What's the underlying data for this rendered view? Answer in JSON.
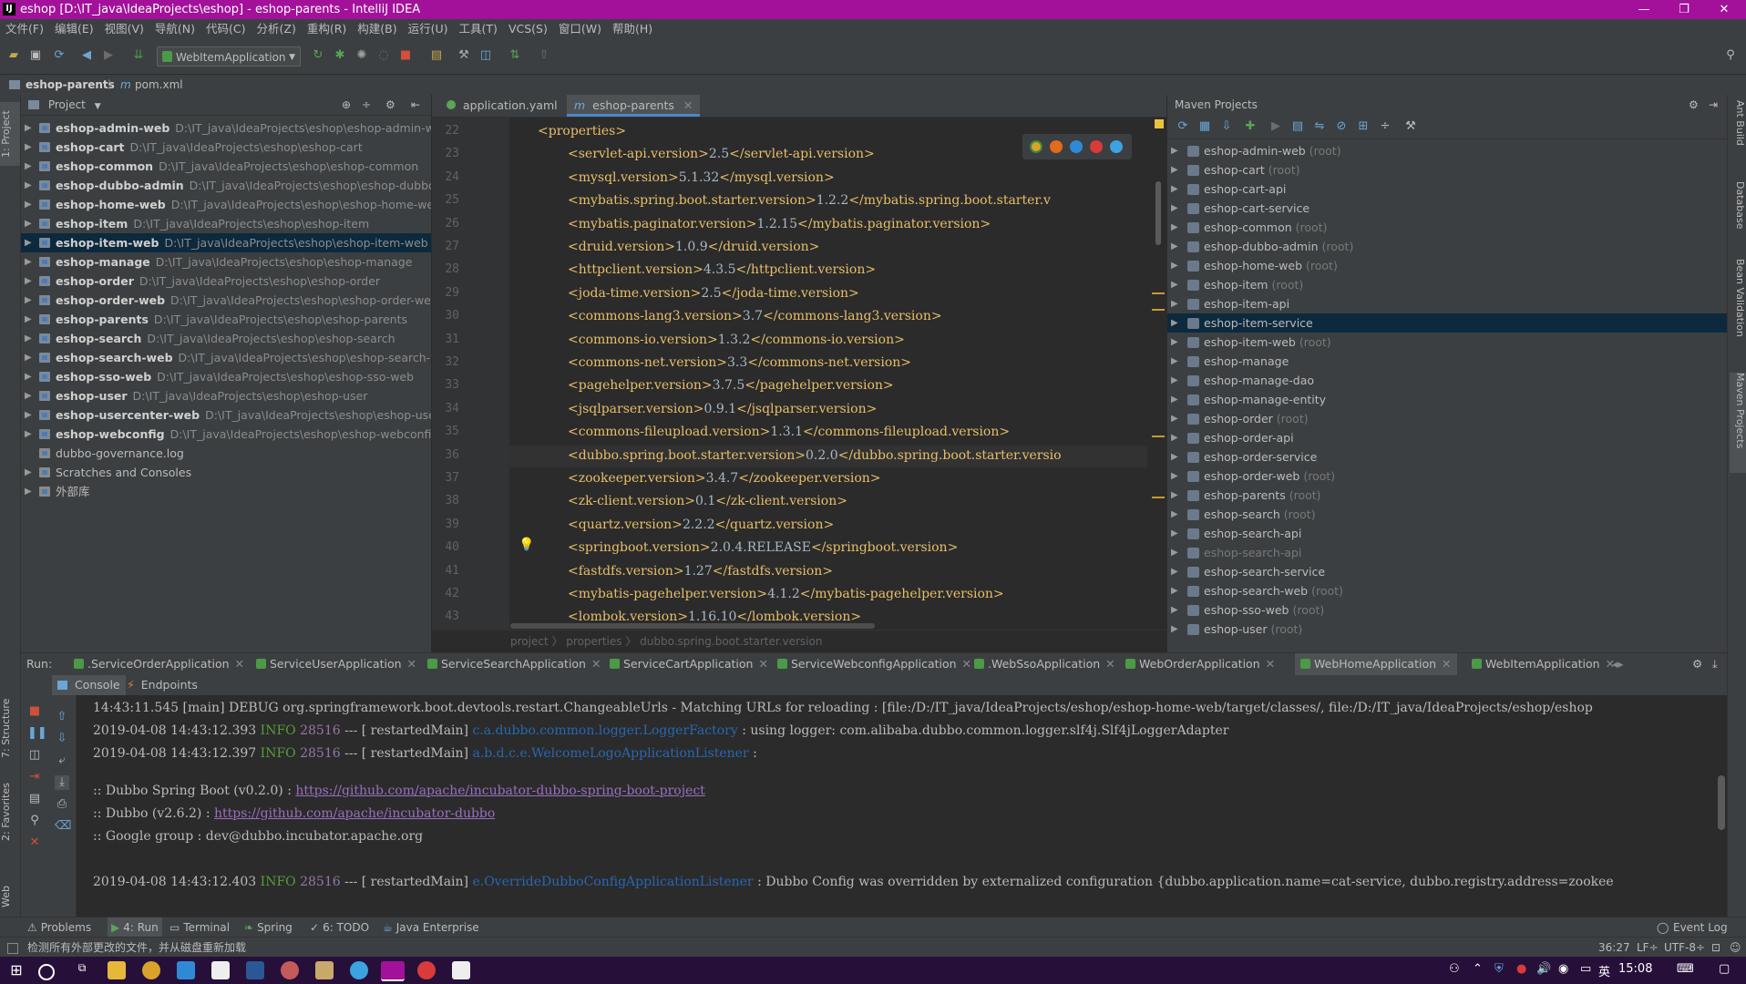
{
  "titlebar": {
    "app_icon": "IJ",
    "title": "eshop [D:\\IT_java\\IdeaProjects\\eshop] - eshop-parents - IntelliJ IDEA",
    "minimize": "—",
    "restore": "❐",
    "close": "✕"
  },
  "menu": [
    "文件(F)",
    "编辑(E)",
    "视图(V)",
    "导航(N)",
    "代码(C)",
    "分析(Z)",
    "重构(R)",
    "构建(B)",
    "运行(U)",
    "工具(T)",
    "VCS(S)",
    "窗口(W)",
    "帮助(H)"
  ],
  "toolbar": {
    "run_config": "WebItemApplication"
  },
  "navbar": {
    "project": "eshop-parents",
    "file_prefix": "m",
    "file": "pom.xml"
  },
  "left_stripe": {
    "project_tab": "1: Project",
    "structure_tab": "7: Structure",
    "favorites_tab": "2: Favorites",
    "web_tab": "Web"
  },
  "project_panel": {
    "header": "Project",
    "items": [
      {
        "name": "eshop-admin-web",
        "path": "D:\\IT_java\\IdeaProjects\\eshop\\eshop-admin-web"
      },
      {
        "name": "eshop-cart",
        "path": "D:\\IT_java\\IdeaProjects\\eshop\\eshop-cart"
      },
      {
        "name": "eshop-common",
        "path": "D:\\IT_java\\IdeaProjects\\eshop\\eshop-common"
      },
      {
        "name": "eshop-dubbo-admin",
        "path": "D:\\IT_java\\IdeaProjects\\eshop\\eshop-dubbo-ad"
      },
      {
        "name": "eshop-home-web",
        "path": "D:\\IT_java\\IdeaProjects\\eshop\\eshop-home-web"
      },
      {
        "name": "eshop-item",
        "path": "D:\\IT_java\\IdeaProjects\\eshop\\eshop-item"
      },
      {
        "name": "eshop-item-web",
        "path": "D:\\IT_java\\IdeaProjects\\eshop\\eshop-item-web"
      },
      {
        "name": "eshop-manage",
        "path": "D:\\IT_java\\IdeaProjects\\eshop\\eshop-manage"
      },
      {
        "name": "eshop-order",
        "path": "D:\\IT_java\\IdeaProjects\\eshop\\eshop-order"
      },
      {
        "name": "eshop-order-web",
        "path": "D:\\IT_java\\IdeaProjects\\eshop\\eshop-order-web"
      },
      {
        "name": "eshop-parents",
        "path": "D:\\IT_java\\IdeaProjects\\eshop\\eshop-parents"
      },
      {
        "name": "eshop-search",
        "path": "D:\\IT_java\\IdeaProjects\\eshop\\eshop-search"
      },
      {
        "name": "eshop-search-web",
        "path": "D:\\IT_java\\IdeaProjects\\eshop\\eshop-search-web"
      },
      {
        "name": "eshop-sso-web",
        "path": "D:\\IT_java\\IdeaProjects\\eshop\\eshop-sso-web"
      },
      {
        "name": "eshop-user",
        "path": "D:\\IT_java\\IdeaProjects\\eshop\\eshop-user"
      },
      {
        "name": "eshop-usercenter-web",
        "path": "D:\\IT_java\\IdeaProjects\\eshop\\eshop-usercent"
      },
      {
        "name": "eshop-webconfig",
        "path": "D:\\IT_java\\IdeaProjects\\eshop\\eshop-webconfig"
      }
    ],
    "selected_index": 6,
    "log_file": "dubbo-governance.log",
    "scratches": "Scratches and Consoles",
    "external_libs": "外部库"
  },
  "editor": {
    "tabs": [
      {
        "label": "application.yaml"
      },
      {
        "label": "eshop-parents",
        "prefix": "m"
      }
    ],
    "lines": [
      {
        "num": "22",
        "indent": 0,
        "open": "<properties>",
        "value": "",
        "close": ""
      },
      {
        "num": "23",
        "indent": 1,
        "open": "<servlet-api.version>",
        "value": "2.5",
        "close": "</servlet-api.version>"
      },
      {
        "num": "24",
        "indent": 1,
        "open": "<mysql.version>",
        "value": "5.1.32",
        "close": "</mysql.version>"
      },
      {
        "num": "25",
        "indent": 1,
        "open": "<mybatis.spring.boot.starter.version>",
        "value": "1.2.2",
        "close": "</mybatis.spring.boot.starter.v"
      },
      {
        "num": "26",
        "indent": 1,
        "open": "<mybatis.paginator.version>",
        "value": "1.2.15",
        "close": "</mybatis.paginator.version>"
      },
      {
        "num": "27",
        "indent": 1,
        "open": "<druid.version>",
        "value": "1.0.9",
        "close": "</druid.version>"
      },
      {
        "num": "28",
        "indent": 1,
        "open": "<httpclient.version>",
        "value": "4.3.5",
        "close": "</httpclient.version>"
      },
      {
        "num": "29",
        "indent": 1,
        "open": "<joda-time.version>",
        "value": "2.5",
        "close": "</joda-time.version>"
      },
      {
        "num": "30",
        "indent": 1,
        "open": "<commons-lang3.version>",
        "value": "3.7",
        "close": "</commons-lang3.version>"
      },
      {
        "num": "31",
        "indent": 1,
        "open": "<commons-io.version>",
        "value": "1.3.2",
        "close": "</commons-io.version>"
      },
      {
        "num": "32",
        "indent": 1,
        "open": "<commons-net.version>",
        "value": "3.3",
        "close": "</commons-net.version>"
      },
      {
        "num": "33",
        "indent": 1,
        "open": "<pagehelper.version>",
        "value": "3.7.5",
        "close": "</pagehelper.version>"
      },
      {
        "num": "34",
        "indent": 1,
        "open": "<jsqlparser.version>",
        "value": "0.9.1",
        "close": "</jsqlparser.version>"
      },
      {
        "num": "35",
        "indent": 1,
        "open": "<commons-fileupload.version>",
        "value": "1.3.1",
        "close": "</commons-fileupload.version>"
      },
      {
        "num": "36",
        "indent": 1,
        "open": "<dubbo.spring.boot.starter.version>",
        "value": "0.2.0",
        "close": "</dubbo.spring.boot.starter.versio"
      },
      {
        "num": "37",
        "indent": 1,
        "open": "<zookeeper.version>",
        "value": "3.4.7",
        "close": "</zookeeper.version>"
      },
      {
        "num": "38",
        "indent": 1,
        "open": "<zk-client.version>",
        "value": "0.1",
        "close": "</zk-client.version>"
      },
      {
        "num": "39",
        "indent": 1,
        "open": "<quartz.version>",
        "value": "2.2.2",
        "close": "</quartz.version>"
      },
      {
        "num": "40",
        "indent": 1,
        "open": "<springboot.version>",
        "value": "2.0.4.RELEASE",
        "close": "</springboot.version>"
      },
      {
        "num": "41",
        "indent": 1,
        "open": "<fastdfs.version>",
        "value": "1.27",
        "close": "</fastdfs.version>"
      },
      {
        "num": "42",
        "indent": 1,
        "open": "<mybatis-pagehelper.version>",
        "value": "4.1.2",
        "close": "</mybatis-pagehelper.version>"
      },
      {
        "num": "43",
        "indent": 1,
        "open": "<lombok.version>",
        "value": "1.16.10",
        "close": "</lombok.version>"
      }
    ],
    "breadcrumb": "project  〉 properties  〉 dubbo.spring.boot.starter.version"
  },
  "maven": {
    "header": "Maven Projects",
    "items": [
      {
        "name": "eshop-admin-web",
        "root": "(root)"
      },
      {
        "name": "eshop-cart",
        "root": "(root)"
      },
      {
        "name": "eshop-cart-api",
        "root": ""
      },
      {
        "name": "eshop-cart-service",
        "root": ""
      },
      {
        "name": "eshop-common",
        "root": "(root)"
      },
      {
        "name": "eshop-dubbo-admin",
        "root": "(root)"
      },
      {
        "name": "eshop-home-web",
        "root": "(root)"
      },
      {
        "name": "eshop-item",
        "root": "(root)"
      },
      {
        "name": "eshop-item-api",
        "root": ""
      },
      {
        "name": "eshop-item-service",
        "root": ""
      },
      {
        "name": "eshop-item-web",
        "root": "(root)"
      },
      {
        "name": "eshop-manage",
        "root": ""
      },
      {
        "name": "eshop-manage-dao",
        "root": ""
      },
      {
        "name": "eshop-manage-entity",
        "root": ""
      },
      {
        "name": "eshop-order",
        "root": "(root)"
      },
      {
        "name": "eshop-order-api",
        "root": ""
      },
      {
        "name": "eshop-order-service",
        "root": ""
      },
      {
        "name": "eshop-order-web",
        "root": "(root)"
      },
      {
        "name": "eshop-parents",
        "root": "(root)"
      },
      {
        "name": "eshop-search",
        "root": "(root)"
      },
      {
        "name": "eshop-search-api",
        "root": ""
      },
      {
        "name": "eshop-search-api",
        "root": "",
        "dim": true
      },
      {
        "name": "eshop-search-service",
        "root": ""
      },
      {
        "name": "eshop-search-web",
        "root": "(root)"
      },
      {
        "name": "eshop-sso-web",
        "root": "(root)"
      },
      {
        "name": "eshop-user",
        "root": "(root)"
      }
    ],
    "selected_index": 9
  },
  "right_stripe": {
    "ant": "Ant Build",
    "database": "Database",
    "bean": "Bean Validation",
    "maven": "Maven Projects"
  },
  "run": {
    "label": "Run:",
    "tabs": [
      ".ServiceOrderApplication",
      "ServiceUserApplication",
      "ServiceSearchApplication",
      "ServiceCartApplication",
      "ServiceWebconfigApplication",
      ".WebSsoApplication",
      "WebOrderApplication",
      "WebHomeApplication",
      "WebItemApplication"
    ],
    "active_index": 7,
    "console_tab": "Console",
    "endpoints_tab": "Endpoints",
    "log": [
      {
        "pre": "14:43:11.545 [main] DEBUG org.springframework.boot.devtools.restart.ChangeableUrls - Matching URLs for reloading : [file:/D:/IT_java/IdeaProjects/eshop/eshop-home-web/target/classes/, file:/D:/IT_java/IdeaProjects/eshop/eshop"
      },
      {
        "time": "2019-04-08 14:43:12.393",
        "level": "INFO",
        "pid": "28516",
        "mid": "--- [  restartedMain]",
        "logger": "c.a.dubbo.common.logger.LoggerFactory",
        "msg": "   : using logger: com.alibaba.dubbo.common.logger.slf4j.Slf4jLoggerAdapter"
      },
      {
        "time": "2019-04-08 14:43:12.397",
        "level": "INFO",
        "pid": "28516",
        "mid": "--- [  restartedMain]",
        "logger": "a.b.d.c.e.WelcomeLogoApplicationListener",
        "msg": " :"
      },
      {
        "pre": " :: Dubbo Spring Boot (v0.2.0) : ",
        "link": "https://github.com/apache/incubator-dubbo-spring-boot-project"
      },
      {
        "pre": " :: Dubbo (v2.6.2) : ",
        "link": "https://github.com/apache/incubator-dubbo"
      },
      {
        "pre": " :: Google group : dev@dubbo.incubator.apache.org"
      },
      {
        "time": "2019-04-08 14:43:12.403",
        "level": "INFO",
        "pid": "28516",
        "mid": "--- [  restartedMain]",
        "logger": "e.OverrideDubboConfigApplicationListener",
        "msg": " : Dubbo Config was overridden by externalized configuration {dubbo.application.name=cat-service, dubbo.registry.address=zookee"
      }
    ]
  },
  "bottom_tabs": [
    "Problems",
    "4: Run",
    "Terminal",
    "Spring",
    "6: TODO",
    "Java Enterprise"
  ],
  "event_log": "Event Log",
  "status": {
    "message": "检测所有外部更改的文件，并从磁盘重新加载",
    "position": "36:27",
    "line_sep": "LF÷",
    "encoding": "UTF-8÷"
  },
  "taskbar": {
    "time": "15:08",
    "lang": "英"
  }
}
